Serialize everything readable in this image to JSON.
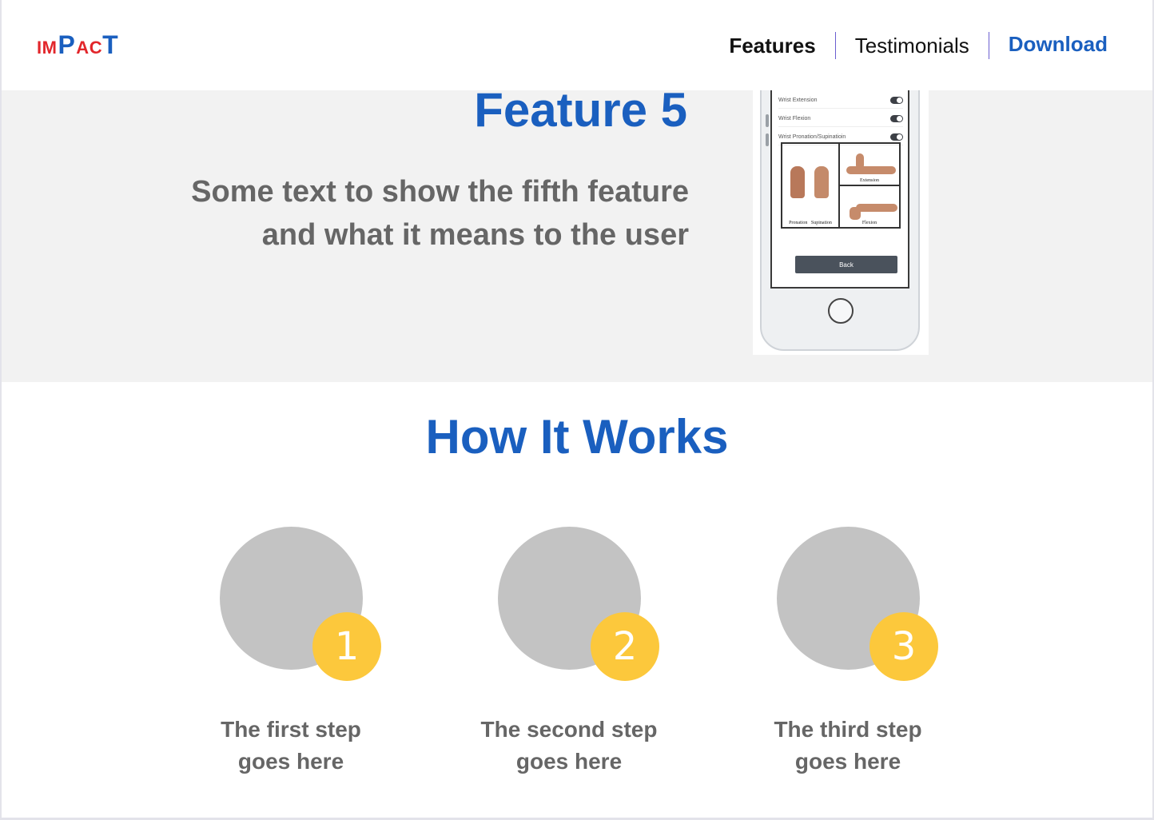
{
  "header": {
    "logo": {
      "letters": [
        "I",
        "M",
        "P",
        "A",
        "C",
        "T"
      ],
      "colors": {
        "red": "#e2262b",
        "blue": "#1a5fbf"
      }
    },
    "nav": {
      "features": "Features",
      "testimonials": "Testimonials",
      "download": "Download"
    }
  },
  "feature": {
    "title": "Feature 5",
    "text_line1": "Some text to show the fifth feature",
    "text_line2": "and what it means to the user",
    "phone": {
      "settings": [
        {
          "label": "Wrist Extension",
          "on": true
        },
        {
          "label": "Wrist Flexion",
          "on": true
        },
        {
          "label": "Wrist Pronation/Supinatioin",
          "on": true
        }
      ],
      "poses": {
        "pronation": "Pronation",
        "supination": "Supination",
        "extension": "Extension",
        "flexion": "Flexion"
      },
      "back_label": "Back"
    }
  },
  "how": {
    "title": "How It Works",
    "steps": [
      {
        "number": "1",
        "line1": "The first step",
        "line2": "goes here"
      },
      {
        "number": "2",
        "line1": "The second step",
        "line2": "goes here"
      },
      {
        "number": "3",
        "line1": "The third step",
        "line2": "goes here"
      }
    ]
  },
  "colors": {
    "accent_blue": "#1a5fbf",
    "step_badge_yellow": "#fcc83c",
    "placeholder_gray": "#c3c3c3",
    "section_bg": "#f2f2f2"
  }
}
